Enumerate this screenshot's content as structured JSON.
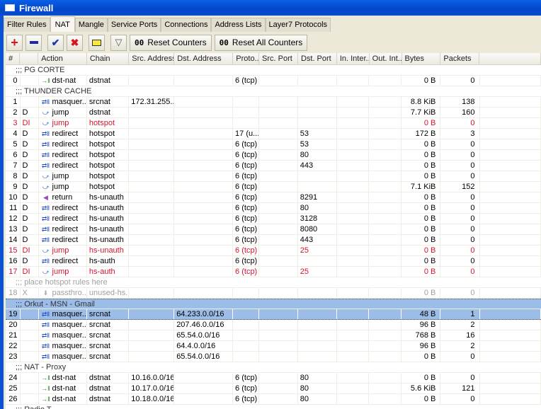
{
  "window": {
    "title": "Firewall"
  },
  "tabs": [
    "Filter Rules",
    "NAT",
    "Mangle",
    "Service Ports",
    "Connections",
    "Address Lists",
    "Layer7 Protocols"
  ],
  "active_tab": "NAT",
  "toolbar": {
    "reset_counters": "Reset Counters",
    "reset_all_counters": "Reset All Counters",
    "counter_glyph": "00"
  },
  "columns": [
    "#",
    "",
    "Action",
    "Chain",
    "Src. Address",
    "Dst. Address",
    "Proto...",
    "Src. Port",
    "Dst. Port",
    "In. Inter...",
    "Out. Int...",
    "Bytes",
    "Packets"
  ],
  "colors": {
    "disabled": "#d9122c",
    "selected": "#9bbde8",
    "title": "#0a52d8"
  },
  "rows": [
    {
      "comment": ";;; PG CORTE"
    },
    {
      "n": "0",
      "f": "",
      "action": "dst-nat",
      "icon": "dst-nat-icon",
      "chain": "dstnat",
      "src": "",
      "dst": "",
      "proto": "6 (tcp)",
      "sport": "",
      "dport": "",
      "in": "",
      "out": "",
      "bytes": "0 B",
      "packets": "0"
    },
    {
      "comment": ";;; THUNDER CACHE"
    },
    {
      "n": "1",
      "f": "",
      "action": "masquer...",
      "icon": "masquerade-icon",
      "chain": "srcnat",
      "src": "172.31.255...",
      "dst": "",
      "proto": "",
      "sport": "",
      "dport": "",
      "in": "",
      "out": "",
      "bytes": "8.8 KiB",
      "packets": "138"
    },
    {
      "n": "2",
      "f": "D",
      "action": "jump",
      "icon": "jump-icon",
      "chain": "dstnat",
      "src": "",
      "dst": "",
      "proto": "",
      "sport": "",
      "dport": "",
      "in": "",
      "out": "",
      "bytes": "7.7 KiB",
      "packets": "160"
    },
    {
      "n": "3",
      "f": "DI",
      "state": "dis",
      "action": "jump",
      "icon": "jump-icon",
      "chain": "hotspot",
      "src": "",
      "dst": "",
      "proto": "",
      "sport": "",
      "dport": "",
      "in": "",
      "out": "",
      "bytes": "0 B",
      "packets": "0"
    },
    {
      "n": "4",
      "f": "D",
      "action": "redirect",
      "icon": "redirect-icon",
      "chain": "hotspot",
      "src": "",
      "dst": "",
      "proto": "17 (u...",
      "sport": "",
      "dport": "53",
      "in": "",
      "out": "",
      "bytes": "172 B",
      "packets": "3"
    },
    {
      "n": "5",
      "f": "D",
      "action": "redirect",
      "icon": "redirect-icon",
      "chain": "hotspot",
      "src": "",
      "dst": "",
      "proto": "6 (tcp)",
      "sport": "",
      "dport": "53",
      "in": "",
      "out": "",
      "bytes": "0 B",
      "packets": "0"
    },
    {
      "n": "6",
      "f": "D",
      "action": "redirect",
      "icon": "redirect-icon",
      "chain": "hotspot",
      "src": "",
      "dst": "",
      "proto": "6 (tcp)",
      "sport": "",
      "dport": "80",
      "in": "",
      "out": "",
      "bytes": "0 B",
      "packets": "0"
    },
    {
      "n": "7",
      "f": "D",
      "action": "redirect",
      "icon": "redirect-icon",
      "chain": "hotspot",
      "src": "",
      "dst": "",
      "proto": "6 (tcp)",
      "sport": "",
      "dport": "443",
      "in": "",
      "out": "",
      "bytes": "0 B",
      "packets": "0"
    },
    {
      "n": "8",
      "f": "D",
      "action": "jump",
      "icon": "jump-icon",
      "chain": "hotspot",
      "src": "",
      "dst": "",
      "proto": "6 (tcp)",
      "sport": "",
      "dport": "",
      "in": "",
      "out": "",
      "bytes": "0 B",
      "packets": "0"
    },
    {
      "n": "9",
      "f": "D",
      "action": "jump",
      "icon": "jump-icon",
      "chain": "hotspot",
      "src": "",
      "dst": "",
      "proto": "6 (tcp)",
      "sport": "",
      "dport": "",
      "in": "",
      "out": "",
      "bytes": "7.1 KiB",
      "packets": "152"
    },
    {
      "n": "10",
      "f": "D",
      "action": "return",
      "icon": "return-icon",
      "chain": "hs-unauth",
      "src": "",
      "dst": "",
      "proto": "6 (tcp)",
      "sport": "",
      "dport": "8291",
      "in": "",
      "out": "",
      "bytes": "0 B",
      "packets": "0"
    },
    {
      "n": "11",
      "f": "D",
      "action": "redirect",
      "icon": "redirect-icon",
      "chain": "hs-unauth",
      "src": "",
      "dst": "",
      "proto": "6 (tcp)",
      "sport": "",
      "dport": "80",
      "in": "",
      "out": "",
      "bytes": "0 B",
      "packets": "0"
    },
    {
      "n": "12",
      "f": "D",
      "action": "redirect",
      "icon": "redirect-icon",
      "chain": "hs-unauth",
      "src": "",
      "dst": "",
      "proto": "6 (tcp)",
      "sport": "",
      "dport": "3128",
      "in": "",
      "out": "",
      "bytes": "0 B",
      "packets": "0"
    },
    {
      "n": "13",
      "f": "D",
      "action": "redirect",
      "icon": "redirect-icon",
      "chain": "hs-unauth",
      "src": "",
      "dst": "",
      "proto": "6 (tcp)",
      "sport": "",
      "dport": "8080",
      "in": "",
      "out": "",
      "bytes": "0 B",
      "packets": "0"
    },
    {
      "n": "14",
      "f": "D",
      "action": "redirect",
      "icon": "redirect-icon",
      "chain": "hs-unauth",
      "src": "",
      "dst": "",
      "proto": "6 (tcp)",
      "sport": "",
      "dport": "443",
      "in": "",
      "out": "",
      "bytes": "0 B",
      "packets": "0"
    },
    {
      "n": "15",
      "f": "DI",
      "state": "dis",
      "action": "jump",
      "icon": "jump-icon",
      "chain": "hs-unauth",
      "src": "",
      "dst": "",
      "proto": "6 (tcp)",
      "sport": "",
      "dport": "25",
      "in": "",
      "out": "",
      "bytes": "0 B",
      "packets": "0"
    },
    {
      "n": "16",
      "f": "D",
      "action": "redirect",
      "icon": "redirect-icon",
      "chain": "hs-auth",
      "src": "",
      "dst": "",
      "proto": "6 (tcp)",
      "sport": "",
      "dport": "",
      "in": "",
      "out": "",
      "bytes": "0 B",
      "packets": "0"
    },
    {
      "n": "17",
      "f": "DI",
      "state": "dis",
      "action": "jump",
      "icon": "jump-icon",
      "chain": "hs-auth",
      "src": "",
      "dst": "",
      "proto": "6 (tcp)",
      "sport": "",
      "dport": "25",
      "in": "",
      "out": "",
      "bytes": "0 B",
      "packets": "0"
    },
    {
      "comment": ";;; place hotspot rules here",
      "state": "x"
    },
    {
      "n": "18",
      "f": "X",
      "state": "x",
      "action": "passthro...",
      "icon": "passthrough-icon",
      "chain": "unused-hs...",
      "src": "",
      "dst": "",
      "proto": "",
      "sport": "",
      "dport": "",
      "in": "",
      "out": "",
      "bytes": "0 B",
      "packets": "0"
    },
    {
      "comment": ";;; Orkut - MSN - Gmail",
      "state": "selc"
    },
    {
      "n": "19",
      "f": "",
      "state": "sel",
      "action": "masquer...",
      "icon": "masquerade-icon",
      "chain": "srcnat",
      "src": "",
      "dst": "64.233.0.0/16",
      "proto": "",
      "sport": "",
      "dport": "",
      "in": "",
      "out": "",
      "bytes": "48 B",
      "packets": "1"
    },
    {
      "n": "20",
      "f": "",
      "action": "masquer...",
      "icon": "masquerade-icon",
      "chain": "srcnat",
      "src": "",
      "dst": "207.46.0.0/16",
      "proto": "",
      "sport": "",
      "dport": "",
      "in": "",
      "out": "",
      "bytes": "96 B",
      "packets": "2"
    },
    {
      "n": "21",
      "f": "",
      "action": "masquer...",
      "icon": "masquerade-icon",
      "chain": "srcnat",
      "src": "",
      "dst": "65.54.0.0/16",
      "proto": "",
      "sport": "",
      "dport": "",
      "in": "",
      "out": "",
      "bytes": "768 B",
      "packets": "16"
    },
    {
      "n": "22",
      "f": "",
      "action": "masquer...",
      "icon": "masquerade-icon",
      "chain": "srcnat",
      "src": "",
      "dst": "64.4.0.0/16",
      "proto": "",
      "sport": "",
      "dport": "",
      "in": "",
      "out": "",
      "bytes": "96 B",
      "packets": "2"
    },
    {
      "n": "23",
      "f": "",
      "action": "masquer...",
      "icon": "masquerade-icon",
      "chain": "srcnat",
      "src": "",
      "dst": "65.54.0.0/16",
      "proto": "",
      "sport": "",
      "dport": "",
      "in": "",
      "out": "",
      "bytes": "0 B",
      "packets": "0"
    },
    {
      "comment": ";;; NAT - Proxy"
    },
    {
      "n": "24",
      "f": "",
      "action": "dst-nat",
      "icon": "dst-nat-icon",
      "chain": "dstnat",
      "src": "10.16.0.0/16",
      "dst": "",
      "proto": "6 (tcp)",
      "sport": "",
      "dport": "80",
      "in": "",
      "out": "",
      "bytes": "0 B",
      "packets": "0"
    },
    {
      "n": "25",
      "f": "",
      "action": "dst-nat",
      "icon": "dst-nat-icon",
      "chain": "dstnat",
      "src": "10.17.0.0/16",
      "dst": "",
      "proto": "6 (tcp)",
      "sport": "",
      "dport": "80",
      "in": "",
      "out": "",
      "bytes": "5.6 KiB",
      "packets": "121"
    },
    {
      "n": "26",
      "f": "",
      "action": "dst-nat",
      "icon": "dst-nat-icon",
      "chain": "dstnat",
      "src": "10.18.0.0/16",
      "dst": "",
      "proto": "6 (tcp)",
      "sport": "",
      "dport": "80",
      "in": "",
      "out": "",
      "bytes": "0 B",
      "packets": "0"
    },
    {
      "comment": ";;; Radio T"
    }
  ]
}
